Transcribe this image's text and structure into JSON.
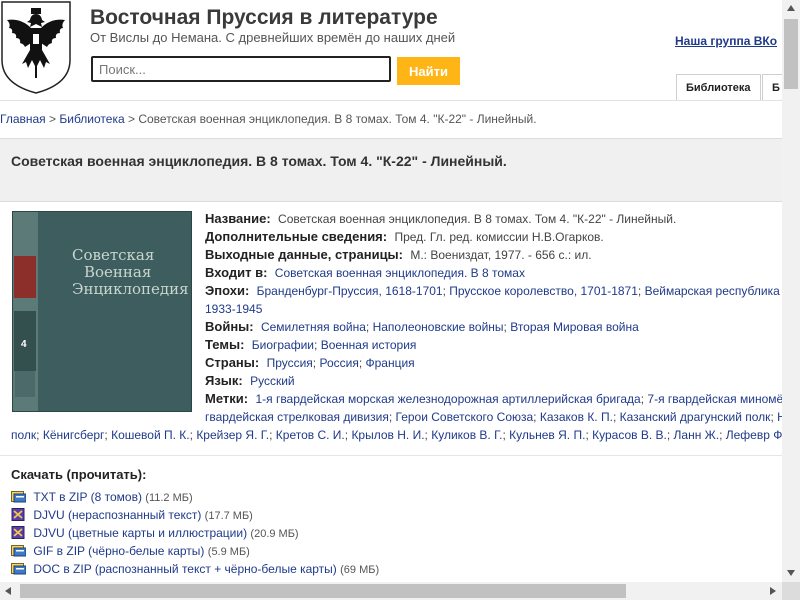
{
  "header": {
    "title": "Восточная Пруссия в литературе",
    "subtitle": "От Вислы до Немана. С древнейших времён до наших дней",
    "search_placeholder": "Поиск...",
    "search_button": "Найти",
    "vk_link": "Наша группа ВКо",
    "tabs": [
      "Библиотека",
      "Б"
    ]
  },
  "breadcrumb": {
    "home": "Главная",
    "sep": ">",
    "library": "Библиотека",
    "current": "Советская военная энциклопедия. В 8 томах. Том 4. \"К-22\" - Линейный."
  },
  "page_title": "Советская военная энциклопедия. В 8 томах. Том 4. \"К-22\" - Линейный.",
  "cover": {
    "line1": "Советская",
    "line2": "Военная",
    "line3": "Энциклопедия",
    "spine_number": "4"
  },
  "fields": {
    "name_label": "Название:",
    "name_value": "Советская военная энциклопедия. В 8 томах. Том 4. \"К-22\" - Линейный.",
    "extra_label": "Дополнительные сведения:",
    "extra_value": "Пред. Гл. ред. комиссии Н.В.Огарков.",
    "imprint_label": "Выходные данные, страницы:",
    "imprint_value": "М.: Воениздат, 1977. - 656 с.: ил.",
    "part_of_label": "Входит в:",
    "part_of_value": "Советская военная энциклопедия. В 8 томах",
    "epochs_label": "Эпохи:",
    "epochs": [
      "Бранденбург-Пруссия, 1618-1701",
      "Прусское королевство, 1701-1871",
      "Веймарская республика"
    ],
    "epochs_cont": "1933-1945",
    "wars_label": "Войны:",
    "wars": [
      "Семилетняя война",
      "Наполеоновские войны",
      "Вторая Мировая война"
    ],
    "themes_label": "Темы:",
    "themes": [
      "Биографии",
      "Военная история"
    ],
    "countries_label": "Страны:",
    "countries": [
      "Пруссия",
      "Россия",
      "Франция"
    ],
    "language_label": "Язык:",
    "language_value": "Русский",
    "tags_label": "Метки:",
    "tags_line1": [
      "1-я гвардейская морская железнодорожная артиллерийская бригада",
      "7-я гвардейская миномё"
    ],
    "tags_line2": [
      "гвардейская стрелковая дивизия",
      "Герои Советского Союза",
      "Казаков К. П.",
      "Казанский драгунский полк",
      "Н"
    ],
    "tags_line3": [
      "полк",
      "Кёнигсберг",
      "Кошевой П. К.",
      "Крейзер Я. Г.",
      "Кретов С. И.",
      "Крылов Н. И.",
      "Куликов В. Г.",
      "Кульнев Я. П.",
      "Курасов В. В.",
      "Ланн Ж.",
      "Лефевр Ф"
    ]
  },
  "downloads": {
    "title": "Скачать (прочитать):",
    "items": [
      {
        "label": "TXT в ZIP (8 томов)",
        "size": "(11.2 МБ)",
        "icon": "zip-icon"
      },
      {
        "label": "DJVU (нераспознанный текст)",
        "size": "(17.7 МБ)",
        "icon": "djvu-icon"
      },
      {
        "label": "DJVU (цветные карты и иллюстрации)",
        "size": "(20.9 МБ)",
        "icon": "djvu-icon"
      },
      {
        "label": "GIF в ZIP (чёрно-белые карты)",
        "size": "(5.9 МБ)",
        "icon": "zip-icon"
      },
      {
        "label": "DOC в ZIP (распознанный текст + чёрно-белые карты)",
        "size": "(69 МБ)",
        "icon": "zip-icon"
      }
    ]
  },
  "colors": {
    "accent": "#ffb515",
    "link": "#1f3a8a",
    "cover": "#3d5d5e"
  }
}
